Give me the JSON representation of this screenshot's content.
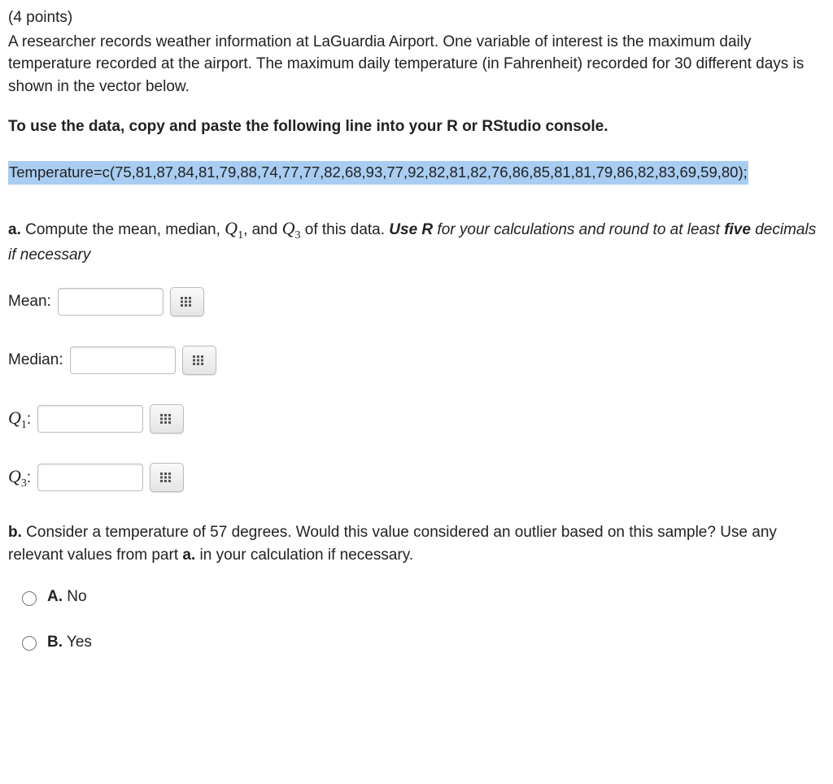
{
  "points": "(4 points)",
  "prompt": "A researcher records weather information at LaGuardia Airport. One variable of interest is the maximum daily temperature recorded at the airport. The maximum daily temperature (in Fahrenheit) recorded for 30 different days is shown in the vector below.",
  "instruction": "To use the data, copy and paste the following line into your R or RStudio console.",
  "code": "Temperature=c(75,81,87,84,81,79,88,74,77,77,82,68,93,77,92,82,81,82,76,86,85,81,81,79,86,82,83,69,59,80);",
  "partA": {
    "prefix": "a.",
    "text1": " Compute the mean, median, ",
    "q1": "Q",
    "q1sub": "1",
    "mid": ", and ",
    "q3": "Q",
    "q3sub": "3",
    "text2": " of this data. ",
    "bolditalic": "Use R",
    "italicrest": " for your calculations and round to at least ",
    "five": "five",
    "italicend": " decimals if necessary"
  },
  "fields": {
    "mean": "Mean:",
    "median": "Median:",
    "q1pre": "Q",
    "q1sub": "1",
    "q1post": ":",
    "q3pre": "Q",
    "q3sub": "3",
    "q3post": ":"
  },
  "partB": {
    "prefix": "b.",
    "text1": " Consider a temperature of 57 degrees. Would this value considered an outlier based on this sample? Use any relevant values from part ",
    "apart": "a.",
    "text2": " in your calculation if necessary."
  },
  "options": {
    "a_letter": "A.",
    "a_text": " No",
    "b_letter": "B.",
    "b_text": " Yes"
  }
}
